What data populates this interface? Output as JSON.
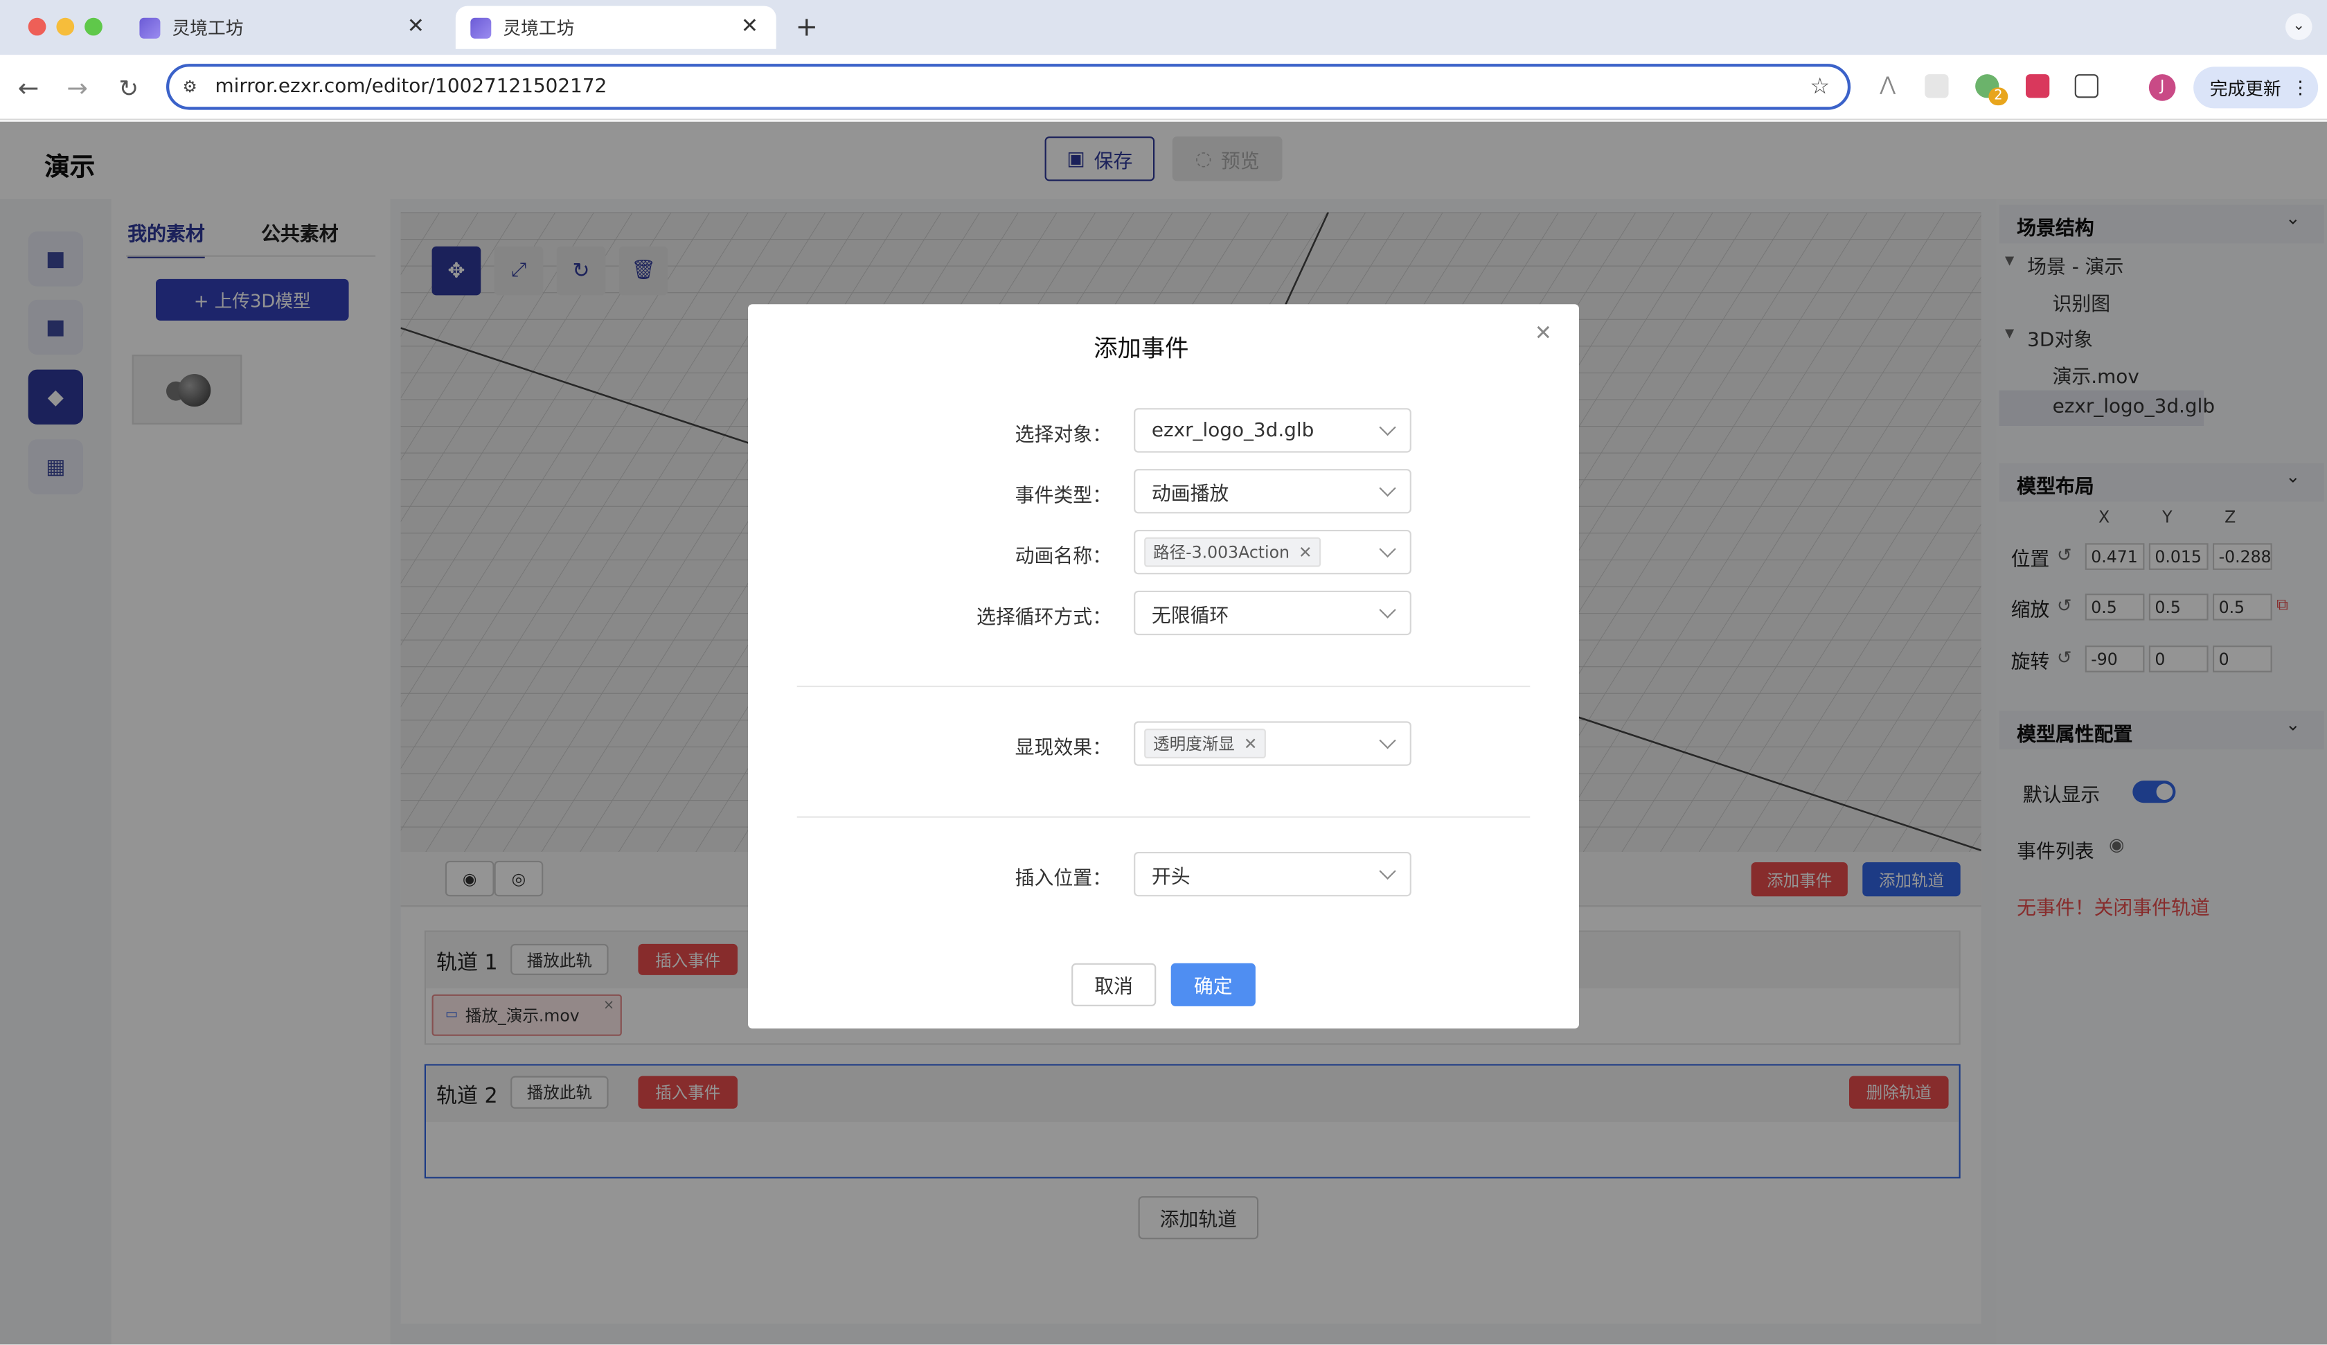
{
  "browser": {
    "tabs": [
      {
        "title": "灵境工坊"
      },
      {
        "title": "灵境工坊"
      }
    ],
    "url": "mirror.ezxr.com/editor/10027121502172",
    "update_button": "完成更新",
    "profile_initial": "J",
    "ext_badge": "2"
  },
  "app": {
    "title": "演示",
    "save_label": "保存",
    "preview_label": "预览"
  },
  "assets": {
    "tabs": [
      "我的素材",
      "公共素材"
    ],
    "upload_label": "+ 上传3D模型"
  },
  "timeline": {
    "add_event": "添加事件",
    "add_track_top": "添加轨道",
    "add_track": "添加轨道",
    "tracks": [
      {
        "name": "轨道 1",
        "play": "播放此轨",
        "insert": "插入事件",
        "clip": "播放_演示.mov"
      },
      {
        "name": "轨道 2",
        "play": "播放此轨",
        "insert": "插入事件",
        "delete": "删除轨道"
      }
    ]
  },
  "scene": {
    "section": "场景结构",
    "root": "场景 - 演示",
    "child1": "识别图",
    "group": "3D对象",
    "item1": "演示.mov",
    "item2": "ezxr_logo_3d.glb"
  },
  "layout_panel": {
    "section": "模型布局",
    "axes": [
      "X",
      "Y",
      "Z"
    ],
    "position": {
      "label": "位置",
      "values": [
        "0.471",
        "0.015",
        "-0.288"
      ]
    },
    "scale": {
      "label": "缩放",
      "values": [
        "0.5",
        "0.5",
        "0.5"
      ]
    },
    "rotation": {
      "label": "旋转",
      "values": [
        "-90",
        "0",
        "0"
      ]
    }
  },
  "props": {
    "section": "模型属性配置",
    "default_show": "默认显示",
    "event_list": "事件列表",
    "no_events": "无事件！关闭事件轨道"
  },
  "modal": {
    "title": "添加事件",
    "fields": [
      {
        "label": "选择对象：",
        "value": "ezxr_logo_3d.glb"
      },
      {
        "label": "事件类型：",
        "value": "动画播放"
      },
      {
        "label": "动画名称：",
        "chip": "路径-3.003Action"
      },
      {
        "label": "选择循环方式：",
        "value": "无限循环"
      },
      {
        "label": "显现效果：",
        "chip": "透明度渐显"
      },
      {
        "label": "插入位置：",
        "value": "开头"
      }
    ],
    "cancel": "取消",
    "confirm": "确定"
  },
  "colors": {
    "accent": "#3366e6",
    "danger": "#e84c4c",
    "nav_dark": "#2f3a9b"
  }
}
